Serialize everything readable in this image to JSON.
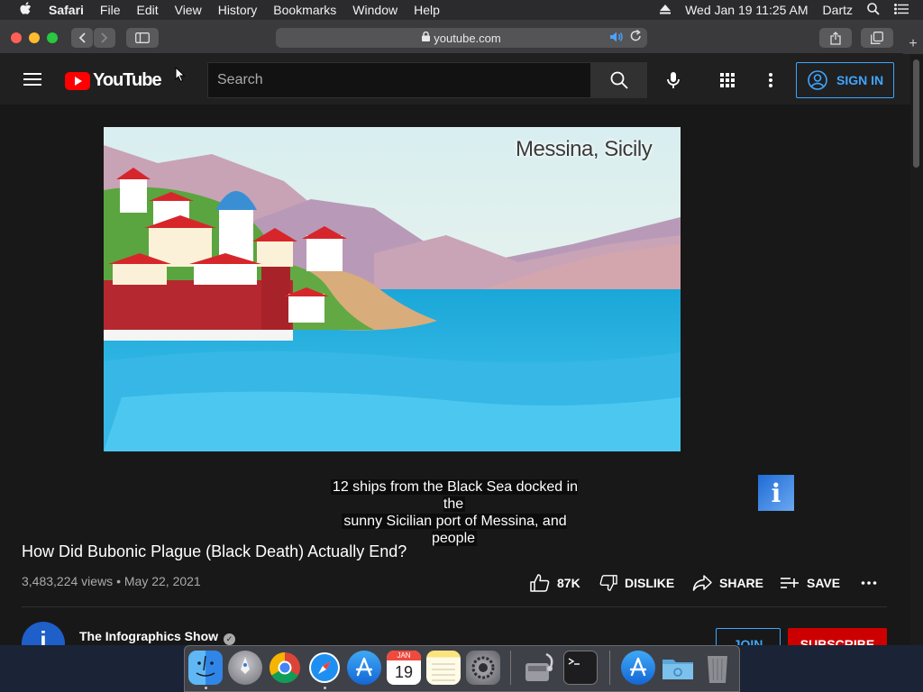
{
  "menubar": {
    "app_name": "Safari",
    "items": [
      "File",
      "Edit",
      "View",
      "History",
      "Bookmarks",
      "Window",
      "Help"
    ],
    "clock": "Wed Jan 19  11:25 AM",
    "user": "Dartz"
  },
  "browser": {
    "url": "youtube.com",
    "new_tab": "+"
  },
  "youtube": {
    "logo_text": "YouTube",
    "search_placeholder": "Search",
    "sign_in": "SIGN IN"
  },
  "video": {
    "overlay_label": "Messina, Sicily",
    "caption_line1": "12 ships from the Black Sea docked in the",
    "caption_line2": "sunny Sicilian port of Messina, and people",
    "info_badge": "i",
    "title": "How Did Bubonic Plague (Black Death) Actually End?",
    "views": "3,483,224 views",
    "date": "May 22, 2021",
    "likes": "87K",
    "dislike": "DISLIKE",
    "share": "SHARE",
    "save": "SAVE",
    "more": "..."
  },
  "channel": {
    "avatar_letter": "i",
    "name": "The Infographics Show",
    "join": "JOIN",
    "subscribe": "SUBSCRIBE"
  },
  "dock": {
    "calendar_month": "JAN",
    "calendar_day": "19"
  },
  "colors": {
    "accent_blue": "#3ea6ff",
    "subscribe_red": "#cc0000",
    "youtube_red": "#ff0000"
  }
}
